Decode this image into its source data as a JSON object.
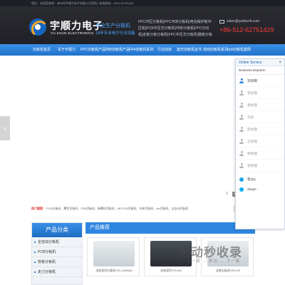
{
  "topbar": {
    "text": "您好，欢迎您来到：苏州市宇顺力电子有限公司官网 | 咨询热线：0512-62751429"
  },
  "header": {
    "logo_cn": "宇顺力电子",
    "logo_en": "YU SHUN ELECTRONICS",
    "slogan_main": "专业生产分板机",
    "slogan_sub": "18年专业电子行业设备",
    "keywords": "FPC冲压分板机|FPC冲床分板机|电池保护板冲压机|PCB冲压式分板机|冲床分板机|FPC分切机|走板分板分板机|FPC冲压式分板机|模板分板",
    "email": "sales@yushunli.com",
    "phone": "+86-512-62751429"
  },
  "nav": {
    "items": [
      "切板机首页",
      "关于宇顺力",
      "FPC切板机产品",
      "冲床切板机产品",
      "FR4切板机系列",
      "行业动态",
      "激光切板机证书",
      "自动切板机系列",
      "pcb切板机案例"
    ]
  },
  "banner": {
    "prev_arrow": "‹",
    "pages": [
      "1",
      "2"
    ]
  },
  "hot_search": {
    "label": "热门搜索：",
    "terms": "PCB分板机、覆铝切板机、FR4切板机、新覆机切板机、MCPCB切板机、冲床切板机、fpc切板机、全自动切板机"
  },
  "category": {
    "title": "产品分类",
    "items": [
      "全自动分板机",
      "PCB分板机",
      "软板分板机",
      "走刀分板机"
    ]
  },
  "products": {
    "title": "产品推荐",
    "cards": [
      {
        "name": "全新双切分板机YSL-2000AD"
      },
      {
        "name": "全新双切YSV-6S"
      },
      {
        "name": "全新分板机YSV-3S"
      }
    ]
  },
  "watermark": {
    "main": "自动秒收录",
    "sub": "上一篇 → 来访 → 下一篇"
  },
  "service": {
    "title": "Online Service",
    "close": "×",
    "department": "Business Departm",
    "staff": [
      "刘华明",
      "李经理",
      "黄经理",
      "刘总",
      "陈经理",
      "王经理",
      "林经理",
      "张经理"
    ],
    "qq": "客QQ",
    "skype": "Skype"
  },
  "colors": {
    "nav_blue": "#2f86e0",
    "phone_red": "#ff3b3b",
    "header_dark": "#25262b"
  }
}
